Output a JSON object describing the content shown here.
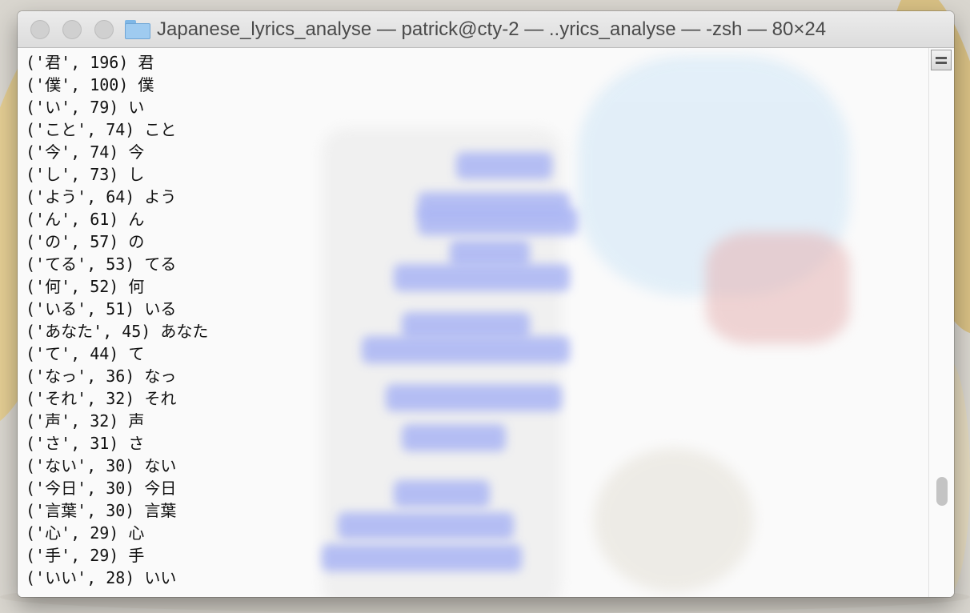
{
  "window": {
    "title": "Japanese_lyrics_analyse — patrick@cty-2 — ..yrics_analyse — -zsh — 80×24",
    "title_icon": "folder-icon"
  },
  "terminal": {
    "lines": [
      "('君', 196) 君",
      "('僕', 100) 僕",
      "('い', 79) い",
      "('こと', 74) こと",
      "('今', 74) 今",
      "('し', 73) し",
      "('よう', 64) よう",
      "('ん', 61) ん",
      "('の', 57) の",
      "('てる', 53) てる",
      "('何', 52) 何",
      "('いる', 51) いる",
      "('あなた', 45) あなた",
      "('て', 44) て",
      "('なっ', 36) なっ",
      "('それ', 32) それ",
      "('声', 32) 声",
      "('さ', 31) さ",
      "('ない', 30) ない",
      "('今日', 30) 今日",
      "('言葉', 30) 言葉",
      "('心', 29) 心",
      "('手', 29) 手",
      "('いい', 28) いい"
    ]
  },
  "colors": {
    "titlebar": "#e0e0e0",
    "text": "#111111",
    "background_tint": "#aab5f4"
  }
}
